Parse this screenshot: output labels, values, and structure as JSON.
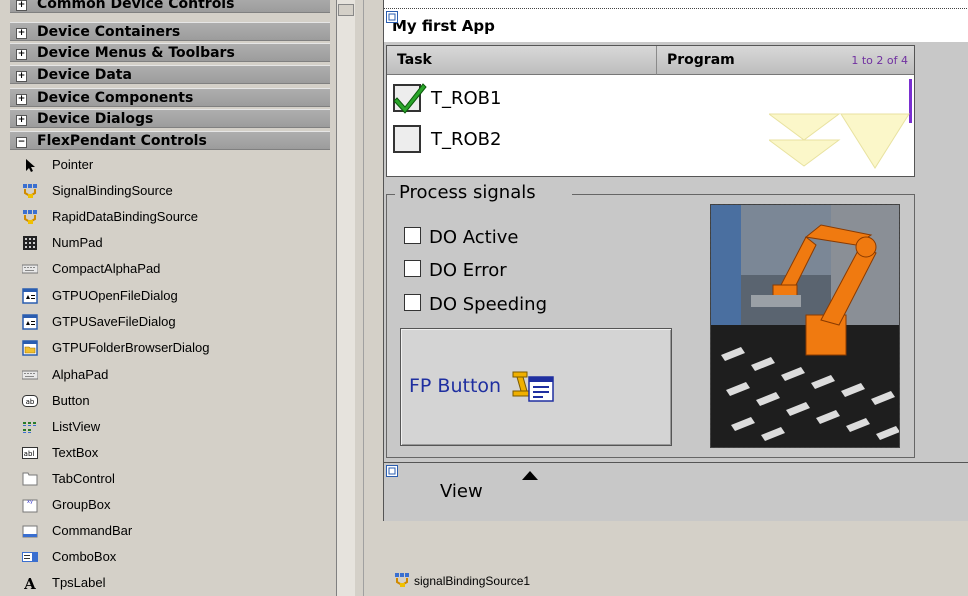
{
  "toolbox": {
    "categories": [
      {
        "label": "Common Device Controls",
        "expanded": false
      },
      {
        "label": "Device Containers",
        "expanded": false
      },
      {
        "label": "Device Menus & Toolbars",
        "expanded": false
      },
      {
        "label": "Device Data",
        "expanded": false
      },
      {
        "label": "Device Components",
        "expanded": false
      },
      {
        "label": "Device Dialogs",
        "expanded": false
      },
      {
        "label": "FlexPendant Controls",
        "expanded": true
      }
    ],
    "items": [
      {
        "label": "Pointer",
        "icon": "pointer-icon"
      },
      {
        "label": "SignalBindingSource",
        "icon": "signal-binding-icon"
      },
      {
        "label": "RapidDataBindingSource",
        "icon": "rapid-binding-icon"
      },
      {
        "label": "NumPad",
        "icon": "numpad-icon"
      },
      {
        "label": "CompactAlphaPad",
        "icon": "keyboard-icon"
      },
      {
        "label": "GTPUOpenFileDialog",
        "icon": "open-file-dialog-icon"
      },
      {
        "label": "GTPUSaveFileDialog",
        "icon": "save-file-dialog-icon"
      },
      {
        "label": "GTPUFolderBrowserDialog",
        "icon": "folder-browser-icon"
      },
      {
        "label": "AlphaPad",
        "icon": "keyboard-icon"
      },
      {
        "label": "Button",
        "icon": "button-icon"
      },
      {
        "label": "ListView",
        "icon": "listview-icon"
      },
      {
        "label": "TextBox",
        "icon": "textbox-icon"
      },
      {
        "label": "TabControl",
        "icon": "tabcontrol-icon"
      },
      {
        "label": "GroupBox",
        "icon": "groupbox-icon"
      },
      {
        "label": "CommandBar",
        "icon": "commandbar-icon"
      },
      {
        "label": "ComboBox",
        "icon": "combobox-icon"
      },
      {
        "label": "TpsLabel",
        "icon": "label-icon"
      }
    ]
  },
  "form": {
    "title": "My first App",
    "list": {
      "headers": [
        "Task",
        "Program"
      ],
      "page_info": "1 to 2 of 4",
      "rows": [
        {
          "label": "T_ROB1",
          "checked": true
        },
        {
          "label": "T_ROB2",
          "checked": false
        }
      ]
    },
    "group": {
      "title": "Process signals",
      "checkboxes": [
        "DO Active",
        "DO Error",
        "DO Speeding"
      ],
      "button_label": "FP Button"
    },
    "command_bar": {
      "label": "View"
    }
  },
  "tray": {
    "component": "signalBindingSource1"
  },
  "colors": {
    "accent_purple": "#7a2fd0",
    "button_text": "#1f2fa0",
    "robot_orange": "#f07a10"
  }
}
